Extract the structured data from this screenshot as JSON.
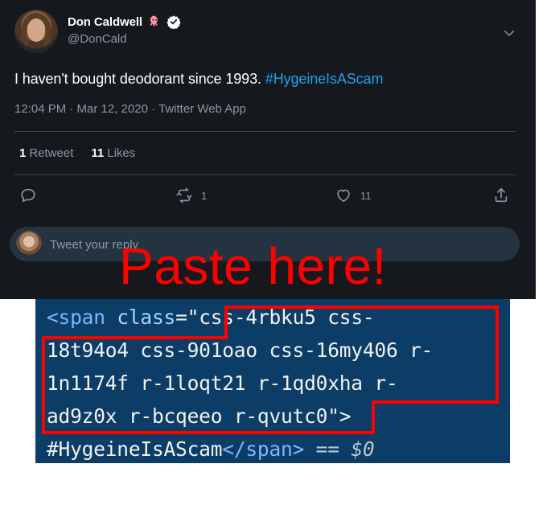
{
  "tweet": {
    "display_name": "Don Caldwell",
    "handle": "@DonCald",
    "text_prefix": "I haven't bought deodorant since 1993.",
    "hashtag": "#HygeineIsAScam",
    "meta": "12:04 PM · Mar 12, 2020 · Twitter Web App",
    "stats": {
      "retweet_count": "1",
      "retweet_label": "Retweet",
      "likes_count": "11",
      "likes_label": "Likes"
    },
    "actions": [
      {
        "name": "reply",
        "icon": "reply-icon",
        "count": ""
      },
      {
        "name": "retweet",
        "icon": "retweet-icon",
        "count": "1"
      },
      {
        "name": "like",
        "icon": "heart-icon",
        "count": "11"
      },
      {
        "name": "share",
        "icon": "share-icon",
        "count": ""
      }
    ],
    "reply_placeholder": "Tweet your reply"
  },
  "overlay": {
    "label": "Paste here!",
    "color": "#ff0000"
  },
  "code": {
    "lines": [
      {
        "tag_open": "<span ",
        "attr": "class",
        "op": "=\"",
        "value": "css-4rbku5 css-"
      },
      {
        "value": "18t94o4 css-901oao css-16my406 r-"
      },
      {
        "value": "1n1174f r-1loqt21 r-1qd0xha r-"
      },
      {
        "value": "ad9z0x r-bcqeeo r-qvutc0",
        "tail": "\">"
      },
      {
        "text": "#HygeineIsAScam",
        "close_tag": "</span>",
        "dev": " == $0"
      }
    ]
  },
  "colors": {
    "panel_bg": "#15181c",
    "link": "#1da1f2",
    "muted": "#8899a6",
    "code_bg": "#0b3d66"
  }
}
